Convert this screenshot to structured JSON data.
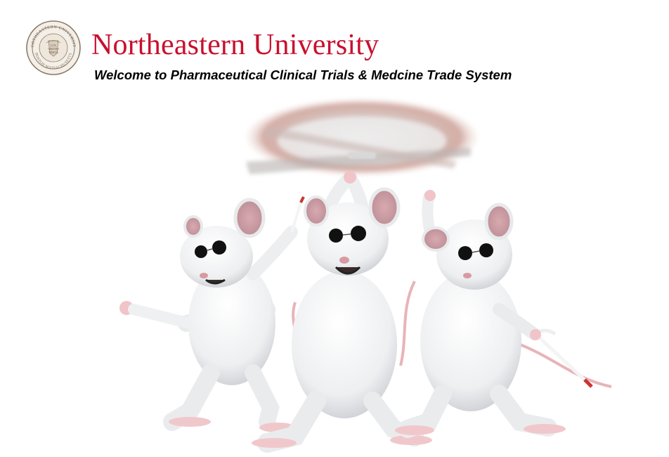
{
  "header": {
    "university_name": "Northeastern University",
    "welcome_text": "Welcome to Pharmaceutical Clinical Trials & Medcine Trade System"
  },
  "seal": {
    "ring_text_top": "NORTHEASTERN UNIVERSITY",
    "ring_text_bottom": "BOSTON MASSACHUSETTS",
    "center_text": "LUX VERITAS VIRTUS"
  },
  "illustration": {
    "subject": "three-blind-mice-with-helicopter-rotor"
  },
  "colors": {
    "brand_red": "#c8102e",
    "text_black": "#000000",
    "seal_brown": "#8a7a66"
  }
}
